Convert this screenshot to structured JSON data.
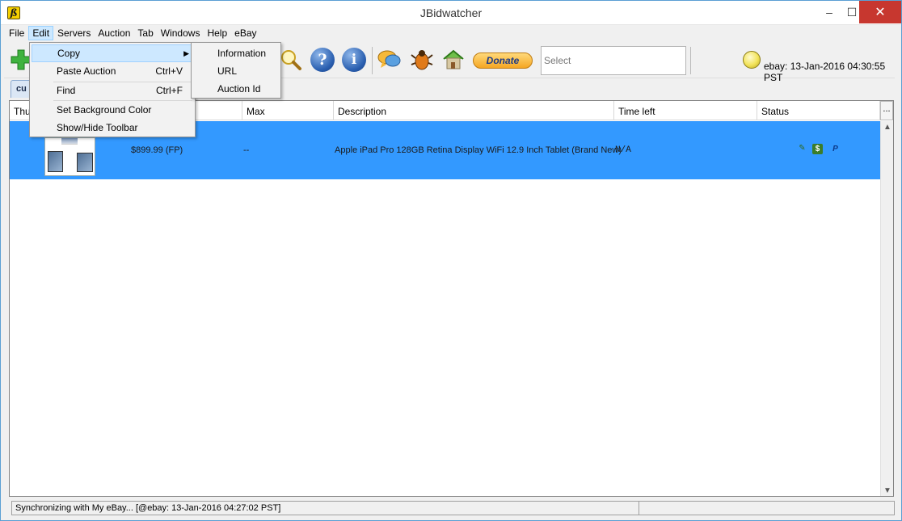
{
  "window": {
    "title": "JBidwatcher"
  },
  "menubar": {
    "items": [
      "File",
      "Edit",
      "Servers",
      "Auction",
      "Tab",
      "Windows",
      "Help",
      "eBay"
    ]
  },
  "toolbar": {
    "donate_label": "Donate",
    "select_placeholder": "Select",
    "clock_text": "ebay: 13-Jan-2016 04:30:55 PST"
  },
  "tab": {
    "label": "cu"
  },
  "table": {
    "columns": [
      "Thu",
      "Max",
      "Description",
      "Time left",
      "Status"
    ],
    "header_more": "...",
    "rows": [
      {
        "current": "$899.99 (FP)",
        "max": "--",
        "description": "Apple iPad Pro 128GB Retina Display WiFi 12.9 Inch Tablet (Brand New)",
        "time_left": "N/A"
      }
    ]
  },
  "statusbar": {
    "text": "Synchronizing with My eBay...  [@ebay: 13-Jan-2016 04:27:02 PST]"
  },
  "edit_menu": {
    "items": [
      {
        "label": "Copy",
        "shortcut": "",
        "submenu": true
      },
      {
        "label": "Paste Auction",
        "shortcut": "Ctrl+V"
      },
      {
        "label": "Find",
        "shortcut": "Ctrl+F"
      },
      {
        "label": "Set Background Color",
        "shortcut": ""
      },
      {
        "label": "Show/Hide Toolbar",
        "shortcut": ""
      }
    ]
  },
  "copy_submenu": {
    "items": [
      "Information",
      "URL",
      "Auction Id"
    ]
  },
  "colors": {
    "selection": "#3399ff",
    "menu_highlight": "#cde8ff",
    "close_button": "#c7372f"
  },
  "icons": [
    "app-icon",
    "add-icon",
    "magnifier-icon",
    "help-icon",
    "info-icon",
    "chat-icon",
    "bug-icon",
    "home-icon",
    "status-light-icon"
  ]
}
